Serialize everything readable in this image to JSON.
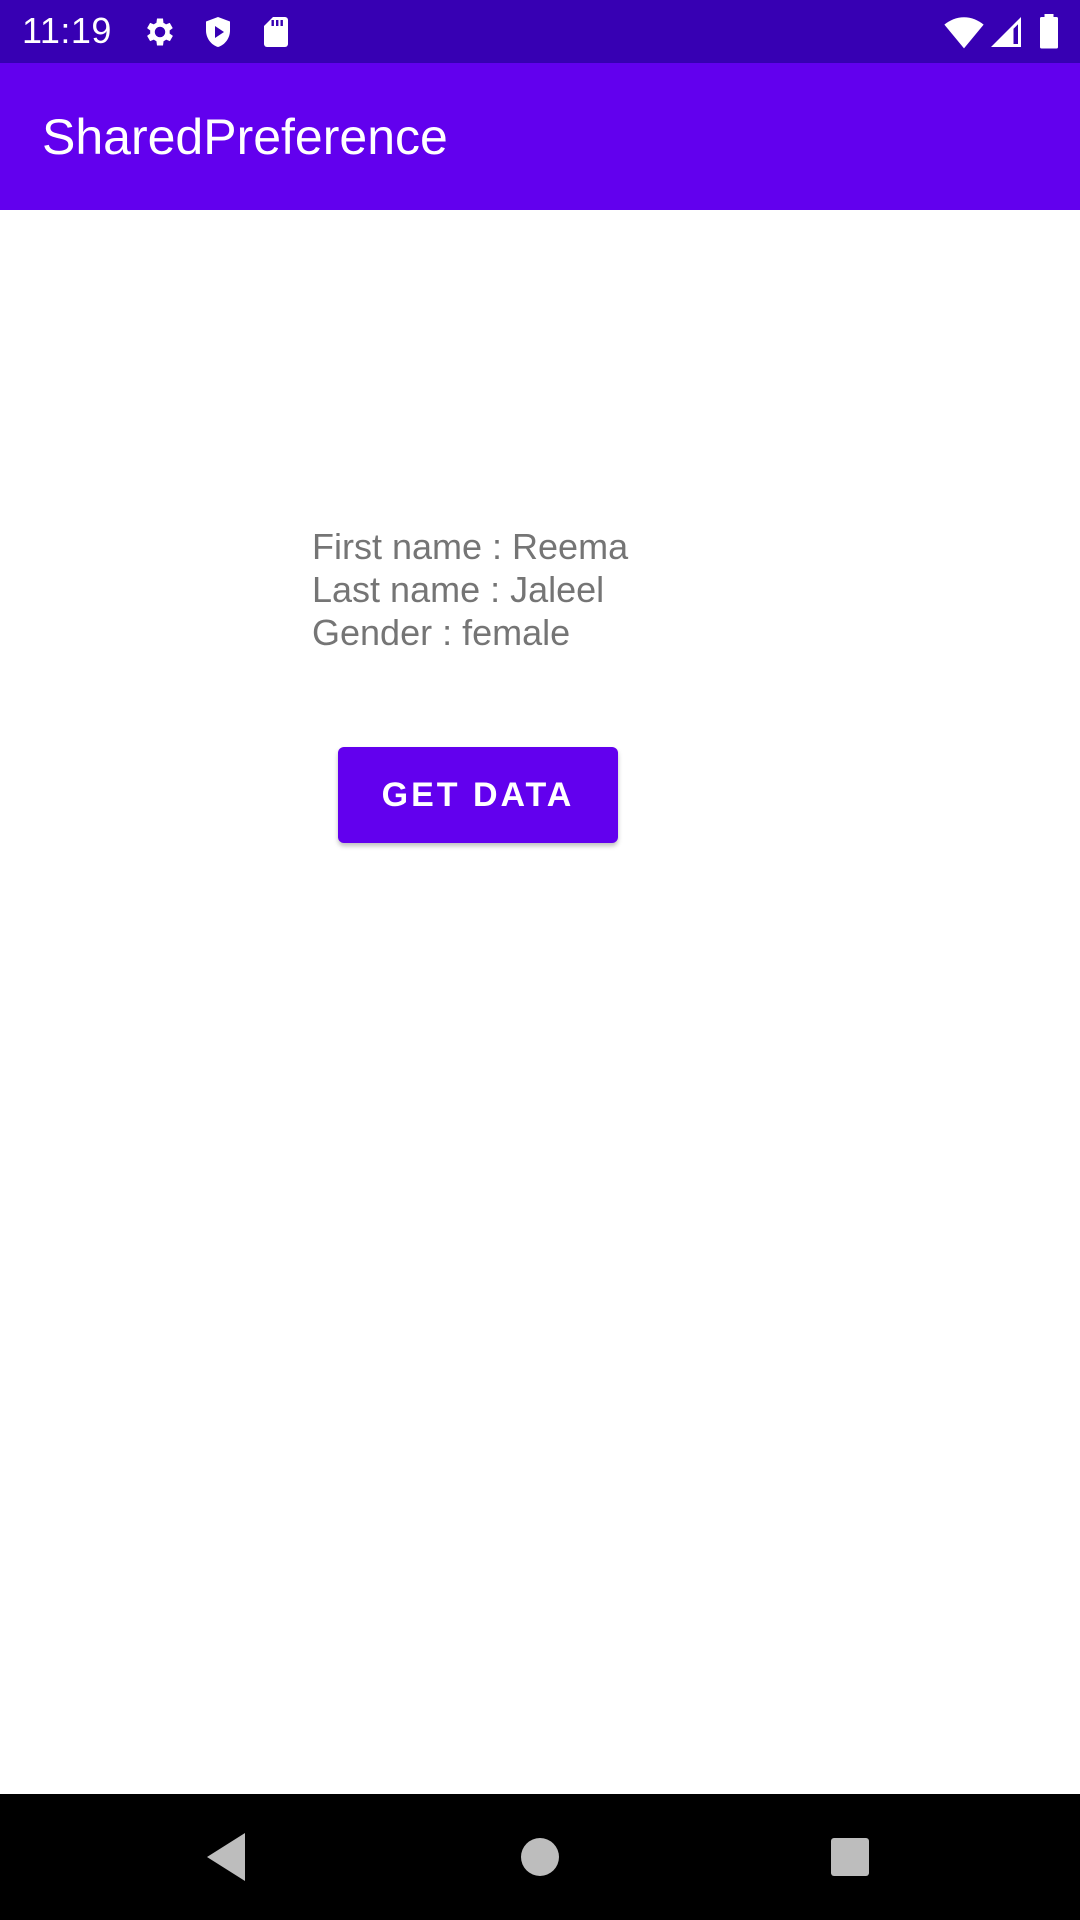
{
  "status_bar": {
    "time": "11:19",
    "icons": [
      "settings-gear-icon",
      "shield-icon",
      "sd-card-icon",
      "wifi-icon",
      "cell-signal-icon",
      "battery-icon"
    ],
    "background": "#3700b3"
  },
  "app_bar": {
    "title": "SharedPreference",
    "background": "#6200ee"
  },
  "profile": {
    "first_name_line": "First name : Reema",
    "last_name_line": "Last name : Jaleel",
    "gender_line": "Gender : female",
    "text_color": "#757575"
  },
  "actions": {
    "get_data_label": "GET DATA",
    "accent": "#6200ee"
  },
  "nav_bar": {
    "icons": [
      "back-icon",
      "home-icon",
      "recents-icon"
    ],
    "background": "#000000"
  }
}
